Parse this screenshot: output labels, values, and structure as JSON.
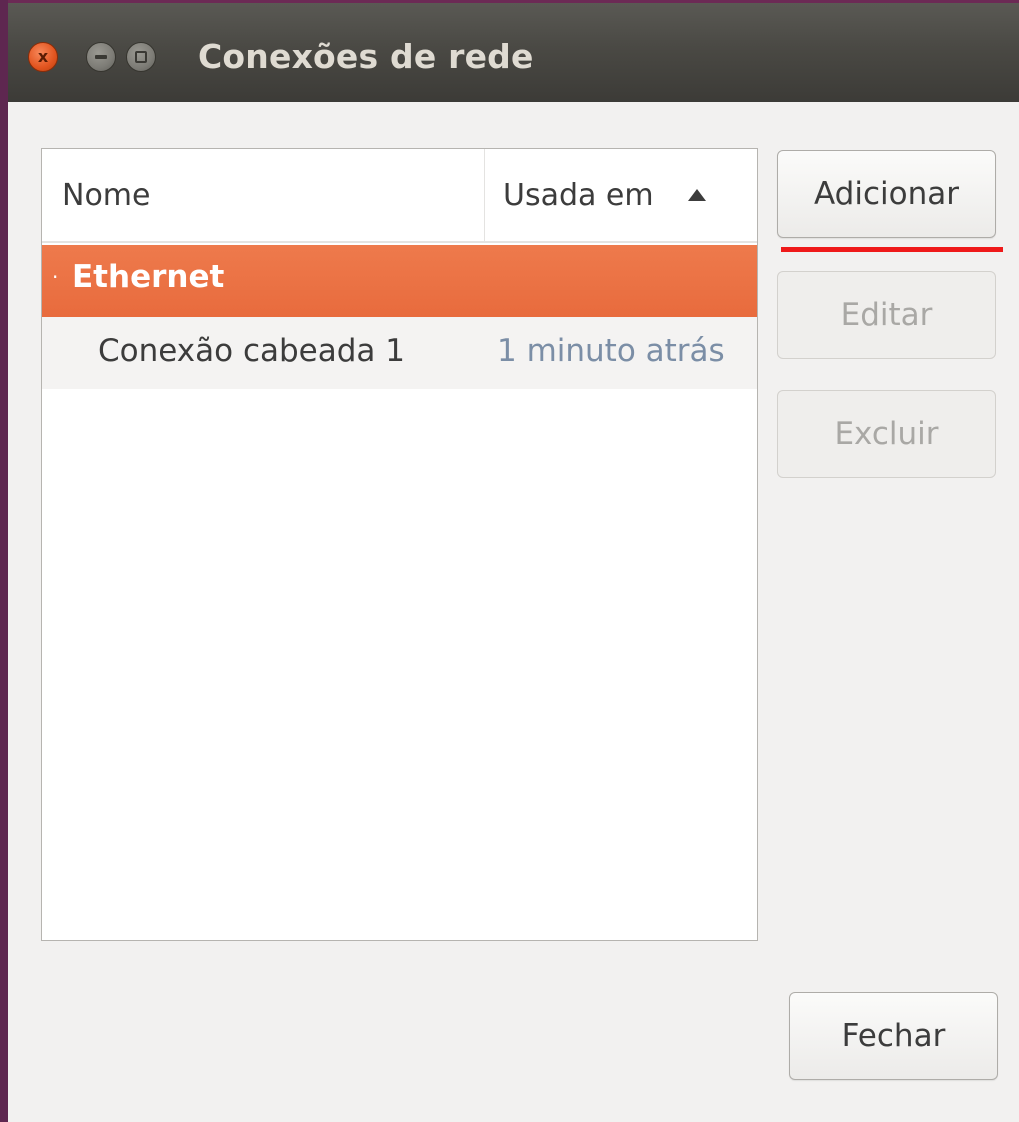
{
  "window": {
    "title": "Conexões de rede",
    "controls": {
      "close_label": "x",
      "minimize_icon": "minimize-icon",
      "maximize_icon": "maximize-icon"
    }
  },
  "list": {
    "columns": [
      "Nome",
      "Usada em"
    ],
    "sort": "ascending",
    "groups": [
      {
        "label": "Ethernet",
        "expanded": true,
        "connections": [
          {
            "name": "Conexão cabeada 1",
            "used": "1 minuto atrás"
          }
        ]
      }
    ]
  },
  "buttons": {
    "add": "Adicionar",
    "edit": "Editar",
    "delete": "Excluir",
    "close": "Fechar"
  },
  "colors": {
    "selection": "#e86b3d",
    "annotation_underline": "#ef1a1a",
    "muted_text": "#7b8ea6"
  }
}
